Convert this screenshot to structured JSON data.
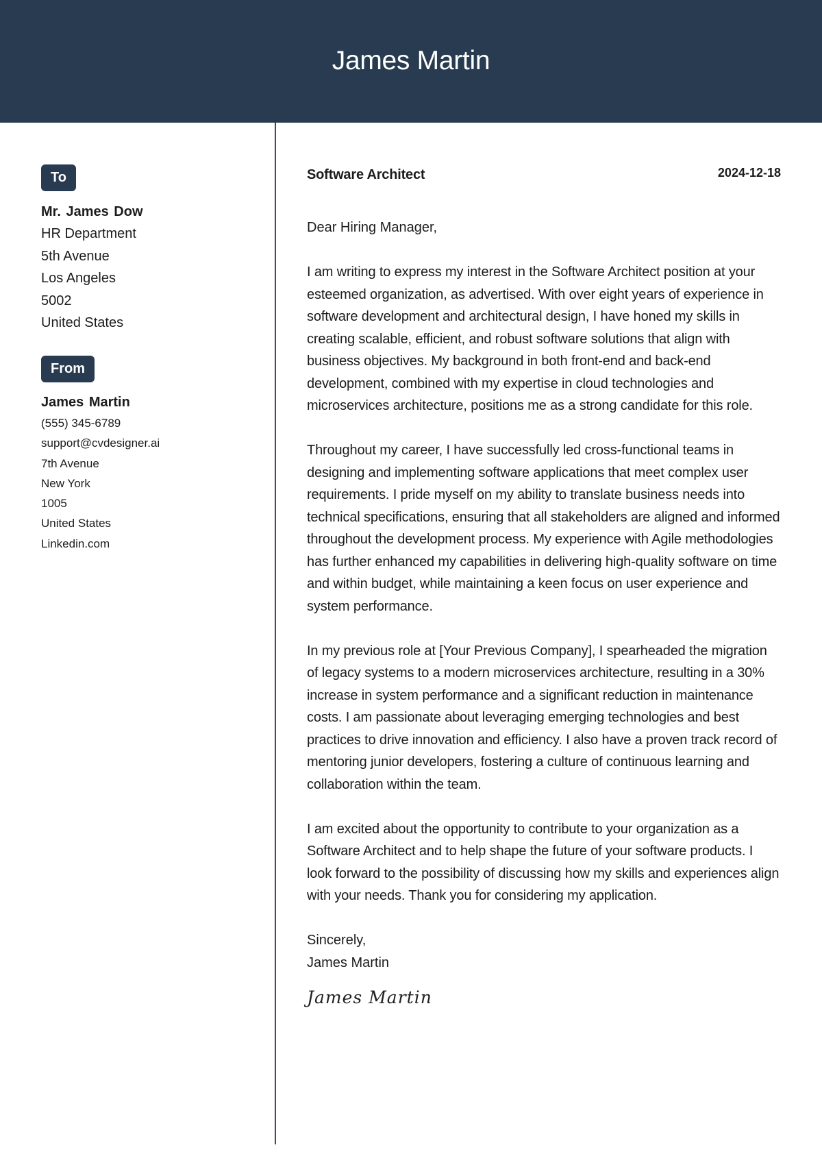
{
  "header": {
    "name": "James Martin",
    "background_color": "#283b50"
  },
  "recipient": {
    "badge_label": "To",
    "name": "Mr. James Dow",
    "lines": [
      "HR Department",
      "5th Avenue",
      "Los Angeles",
      "5002",
      "United States"
    ]
  },
  "sender": {
    "badge_label": "From",
    "name": "James Martin",
    "lines": [
      "(555) 345-6789",
      "support@cvdesigner.ai",
      "7th Avenue",
      "New York",
      "1005",
      "United States",
      "Linkedin.com"
    ]
  },
  "letter": {
    "job_title": "Software Architect",
    "date": "2024-12-18",
    "greeting": "Dear Hiring Manager,",
    "paragraphs": [
      "I am writing to express my interest in the Software Architect position at your esteemed organization, as advertised. With over eight years of experience in software development and architectural design, I have honed my skills in creating scalable, efficient, and robust software solutions that align with business objectives. My background in both front-end and back-end development, combined with my expertise in cloud technologies and microservices architecture, positions me as a strong candidate for this role.",
      "Throughout my career, I have successfully led cross-functional teams in designing and implementing software applications that meet complex user requirements. I pride myself on my ability to translate business needs into technical specifications, ensuring that all stakeholders are aligned and informed throughout the development process. My experience with Agile methodologies has further enhanced my capabilities in delivering high-quality software on time and within budget, while maintaining a keen focus on user experience and system performance.",
      "In my previous role at [Your Previous Company], I spearheaded the migration of legacy systems to a modern microservices architecture, resulting in a 30% increase in system performance and a significant reduction in maintenance costs. I am passionate about leveraging emerging technologies and best practices to drive innovation and efficiency. I also have a proven track record of mentoring junior developers, fostering a culture of continuous learning and collaboration within the team.",
      "I am excited about the opportunity to contribute to your organization as a Software Architect and to help shape the future of your software products. I look forward to the possibility of discussing how my skills and experiences align with your needs. Thank you for considering my application."
    ],
    "closing": "Sincerely,",
    "signer_name": "James Martin",
    "signature": "James Martin"
  }
}
